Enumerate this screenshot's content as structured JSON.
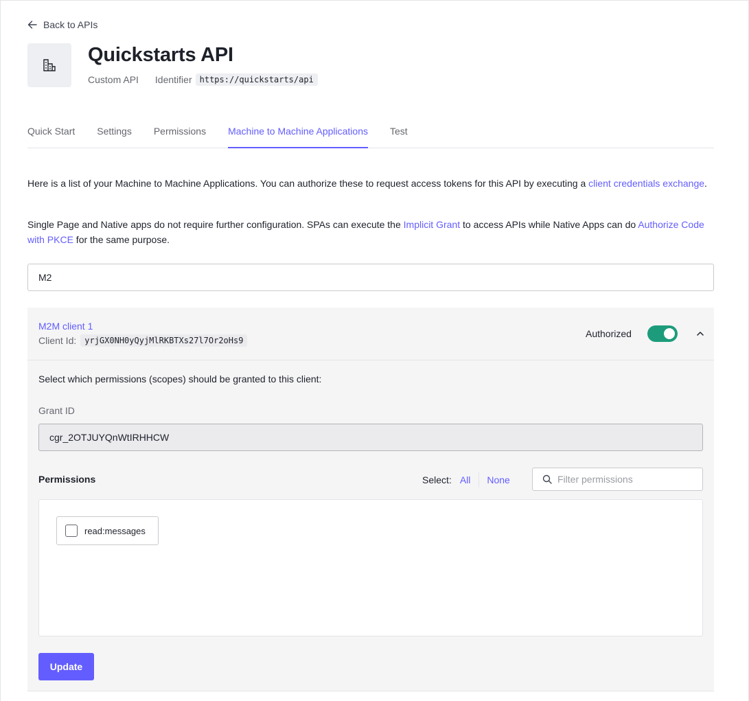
{
  "nav": {
    "back_label": "Back to APIs"
  },
  "api": {
    "title": "Quickstarts API",
    "type": "Custom API",
    "identifier_label": "Identifier",
    "identifier": "https://quickstarts/api"
  },
  "tabs": [
    {
      "label": "Quick Start",
      "active": false
    },
    {
      "label": "Settings",
      "active": false
    },
    {
      "label": "Permissions",
      "active": false
    },
    {
      "label": "Machine to Machine Applications",
      "active": true
    },
    {
      "label": "Test",
      "active": false
    }
  ],
  "intro": {
    "p1_text": "Here is a list of your Machine to Machine Applications. You can authorize these to request access tokens for this API by executing a ",
    "p1_link": "client credentials exchange",
    "p1_end": ".",
    "p2_text1": "Single Page and Native apps do not require further configuration. SPAs can execute the ",
    "p2_link1": "Implicit Grant",
    "p2_text2": " to access APIs while Native Apps can do ",
    "p2_link2": "Authorize Code with PKCE",
    "p2_text3": " for the same purpose."
  },
  "search": {
    "value": "M2"
  },
  "client": {
    "name": "M2M client 1",
    "client_id_label": "Client Id:",
    "client_id": "yrjGX0NH0yQyjMlRKBTXs27l7Or2oHs9",
    "auth_label": "Authorized",
    "authorized": true,
    "scope_intro": "Select which permissions (scopes) should be granted to this client:",
    "grant_label": "Grant ID",
    "grant_id": "cgr_2OTJUYQnWtIRHHCW",
    "permissions_title": "Permissions",
    "select_label": "Select:",
    "select_all": "All",
    "select_none": "None",
    "filter_placeholder": "Filter permissions",
    "permissions": [
      {
        "name": "read:messages",
        "checked": false
      }
    ],
    "update_label": "Update"
  },
  "colors": {
    "accent": "#635dff",
    "toggle_on": "#1c9c7b",
    "text": "#1e212a",
    "muted": "#65676e"
  },
  "icons": [
    "arrow-left-icon",
    "building-icon",
    "chevron-up-icon",
    "search-icon"
  ]
}
